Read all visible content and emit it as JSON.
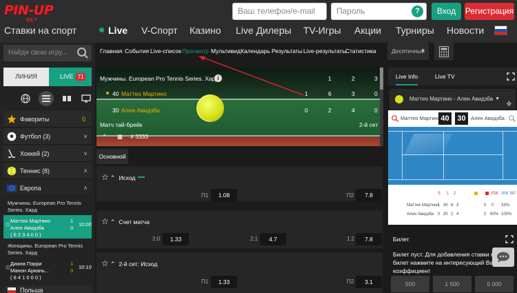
{
  "logo": {
    "main": "PIN-UP",
    "sub": "BET"
  },
  "login": {
    "phone_placeholder": "Ваш телефон/e-mail",
    "password_placeholder": "Пароль",
    "help_glyph": "?",
    "login_label": "Вход",
    "register_label": "Регистрация"
  },
  "nav": {
    "items": [
      "Ставки на спорт",
      "Live",
      "V-Спорт",
      "Казино",
      "Live Дилеры",
      "TV-Игры",
      "Акции",
      "Турниры",
      "Новости"
    ]
  },
  "sidebar": {
    "search_placeholder": "Найди свою игру...",
    "tab_line": "ЛИНИЯ",
    "tab_live": "LIVE",
    "live_count": "71",
    "sports": [
      {
        "label": "Фавориты",
        "count": "0"
      },
      {
        "label": "Футбол (3)",
        "count": ""
      },
      {
        "label": "Хоккей (2)",
        "count": ""
      },
      {
        "label": "Теннис (8)",
        "count": ""
      },
      {
        "label": "Европа",
        "count": ""
      }
    ],
    "league1": "Мужчины. European Pro Tennis Series. Хард",
    "match1": {
      "team1": "Маттео Мартино",
      "team2": "Ален Авидзба",
      "score1": "1",
      "score2": "0",
      "time": "10:00",
      "sets": "( 6 2   3 4   0 0 )"
    },
    "league2": "Женщины. European Pro Tennis Series. Хард",
    "match2": {
      "team1": "Диана Пэрри",
      "team2": "Манон Аркань...",
      "score1": "1",
      "score2": "0",
      "time": "10:10",
      "sets": "( 6 4   1 0   0 0 )"
    },
    "next_country": "Польша"
  },
  "subnav": {
    "items": [
      "Главная",
      "События",
      "Live-список",
      "Просмотр",
      "Мультивид",
      "Календарь",
      "Результаты",
      "Live-результаты",
      "Статистика"
    ],
    "active": "Просмотр"
  },
  "odds_format": "Десятичный",
  "scoreboard": {
    "league": "Мужчины. European Pro Tennis Series. Хард",
    "header_scores": [
      "1",
      "2",
      "3"
    ],
    "p1": {
      "name": "Маттео Мартино",
      "serve": "40",
      "s1": "1",
      "s2": "6",
      "s3": "3",
      "s4": "0"
    },
    "p2": {
      "name": "Ален Авидзба",
      "serve": "30",
      "s1": "0",
      "s2": "2",
      "s3": "4",
      "s4": "0"
    },
    "status": "Матч тай-брейк",
    "set": "2-й сет",
    "event_id": "# 3333"
  },
  "basic_tab": "Основной",
  "markets": [
    {
      "title": "Исход",
      "odds": [
        {
          "label": "П1",
          "value": "1.08"
        },
        {
          "label": "П2",
          "value": "7.8"
        }
      ]
    },
    {
      "title": "Счет матча",
      "odds": [
        {
          "label": "2:0",
          "value": "1.33"
        },
        {
          "label": "2:1",
          "value": "4.7"
        },
        {
          "label": "1:2",
          "value": "7.8"
        }
      ]
    },
    {
      "title": "2-й сет: Исход",
      "odds": [
        {
          "label": "П1",
          "value": "1.33"
        },
        {
          "label": "П2",
          "value": "3.1"
        }
      ]
    }
  ],
  "right": {
    "tab_info": "Live Info",
    "tab_tv": "Live TV",
    "match_select": "Маттео Мартино - Ален Авидзба",
    "p1": "Маттео Мартино",
    "p2": "Ален Авидзба",
    "score1": "40",
    "score2": "30",
    "stats": {
      "hdr": [
        "S",
        "1",
        "2",
        "EW",
        "BW",
        "BP"
      ],
      "r1": {
        "name": "Маттео Мартино",
        "vals": [
          "1",
          "40",
          "6",
          "3",
          "0",
          "0",
          "33%"
        ]
      },
      "r2": {
        "name": "Ален Авидзба",
        "vals": [
          "0",
          "30",
          "2",
          "4",
          "2",
          "60%",
          "100%"
        ]
      }
    },
    "bet_title": "Билет",
    "bet_msg": "Билет пуст. Для добавления ставки в билет нажмите на интересующий Вас коэффициент",
    "amounts": [
      "500",
      "1 500",
      "5 000"
    ]
  }
}
